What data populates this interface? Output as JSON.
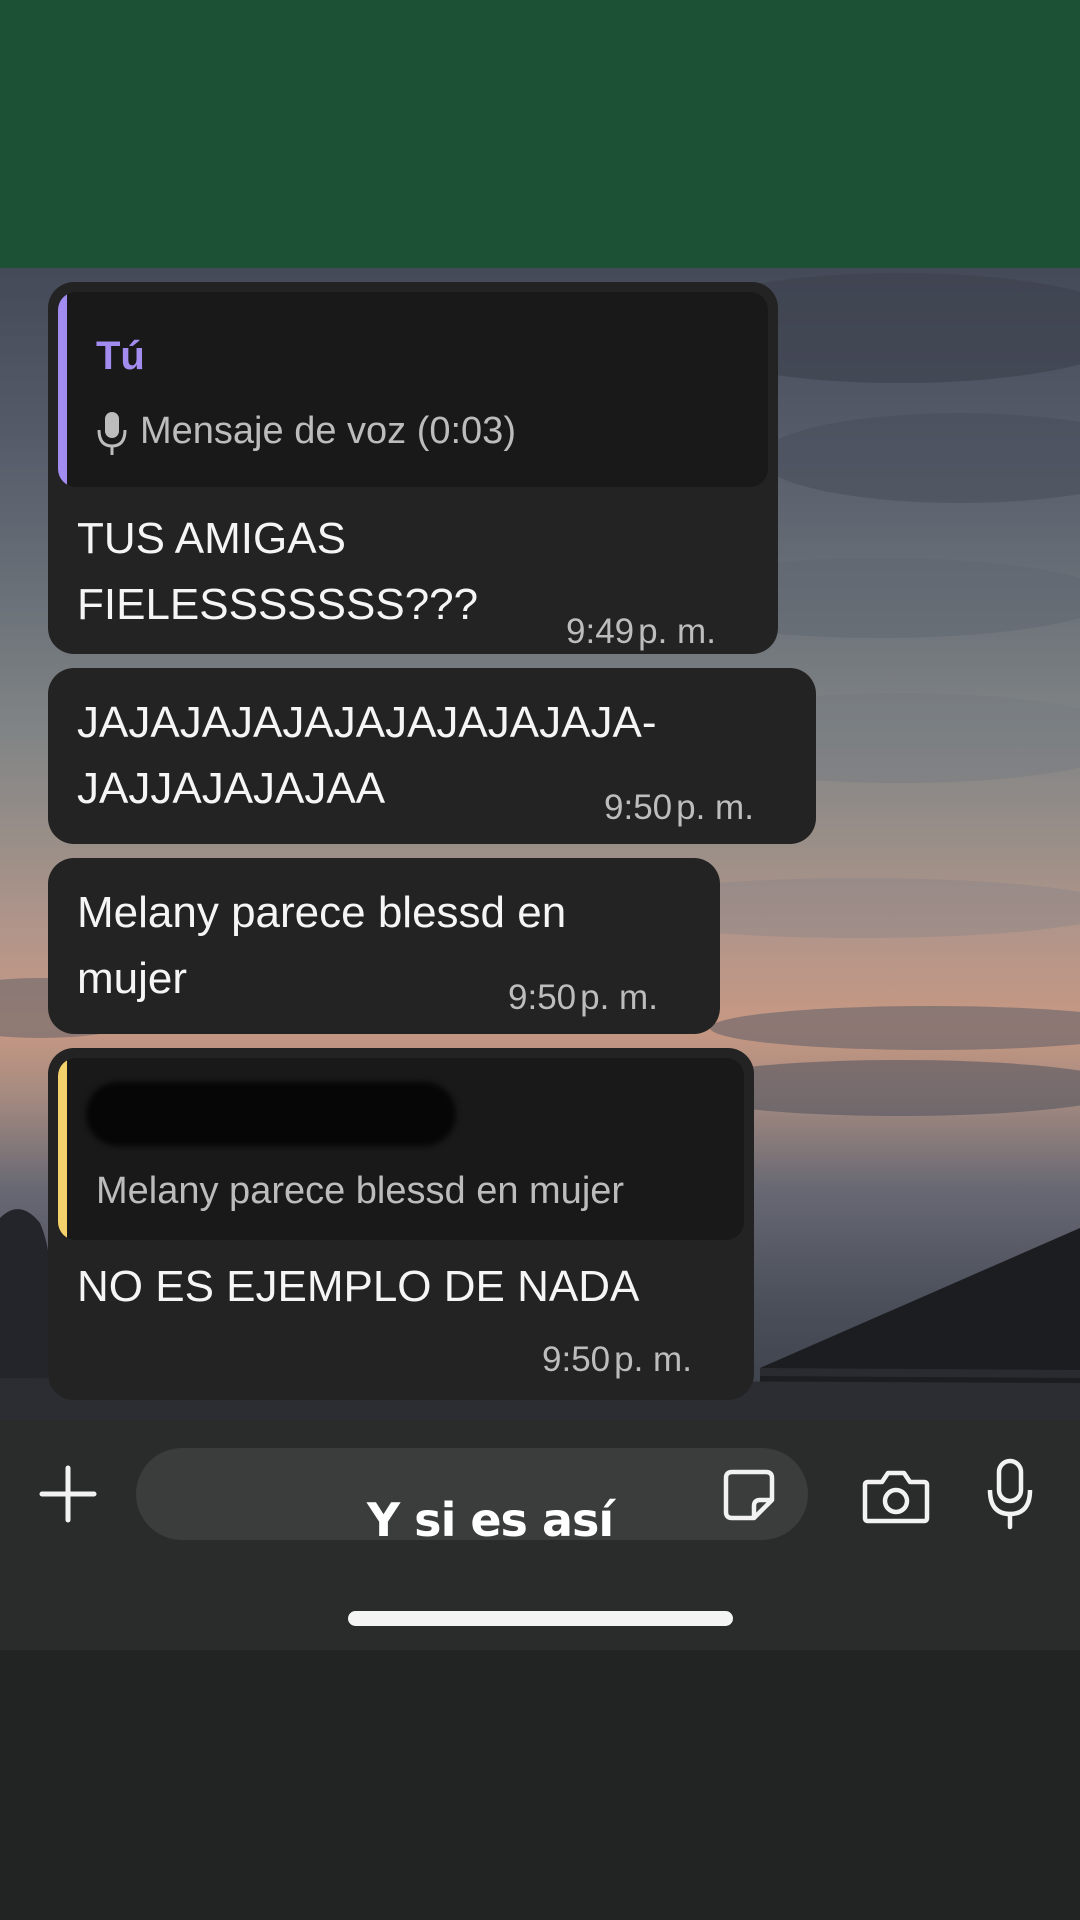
{
  "messages": [
    {
      "reply_to": {
        "author": "Tú",
        "icon": "microphone-icon",
        "text": "Mensaje de voz (0:03)",
        "accent": "#a28cf0"
      },
      "text": "TUS AMIGAS\nFIELESSSSSSS???",
      "time": "9:49",
      "ampm": "p. m."
    },
    {
      "text": "JAJAJAJAJAJAJAJAJAJAJA-\nJAJJAJAJAJAA",
      "time": "9:50",
      "ampm": "p. m."
    },
    {
      "text": "Melany parece blessd en\nmujer",
      "time": "9:50",
      "ampm": "p. m."
    },
    {
      "reply_to": {
        "author_redacted": true,
        "text": "Melany parece blessd en mujer",
        "accent": "#f3d26b"
      },
      "text": "NO ES EJEMPLO DE NADA",
      "time": "9:50",
      "ampm": "p. m."
    }
  ],
  "composer": {
    "add_icon": "plus-icon",
    "sticker_icon": "sticker-icon",
    "camera_icon": "camera-icon",
    "mic_icon": "microphone-icon"
  },
  "overlay_caption": "Y si es así",
  "colors": {
    "top_band": "#1d5136",
    "bubble": "#232323",
    "background": "#212423"
  }
}
